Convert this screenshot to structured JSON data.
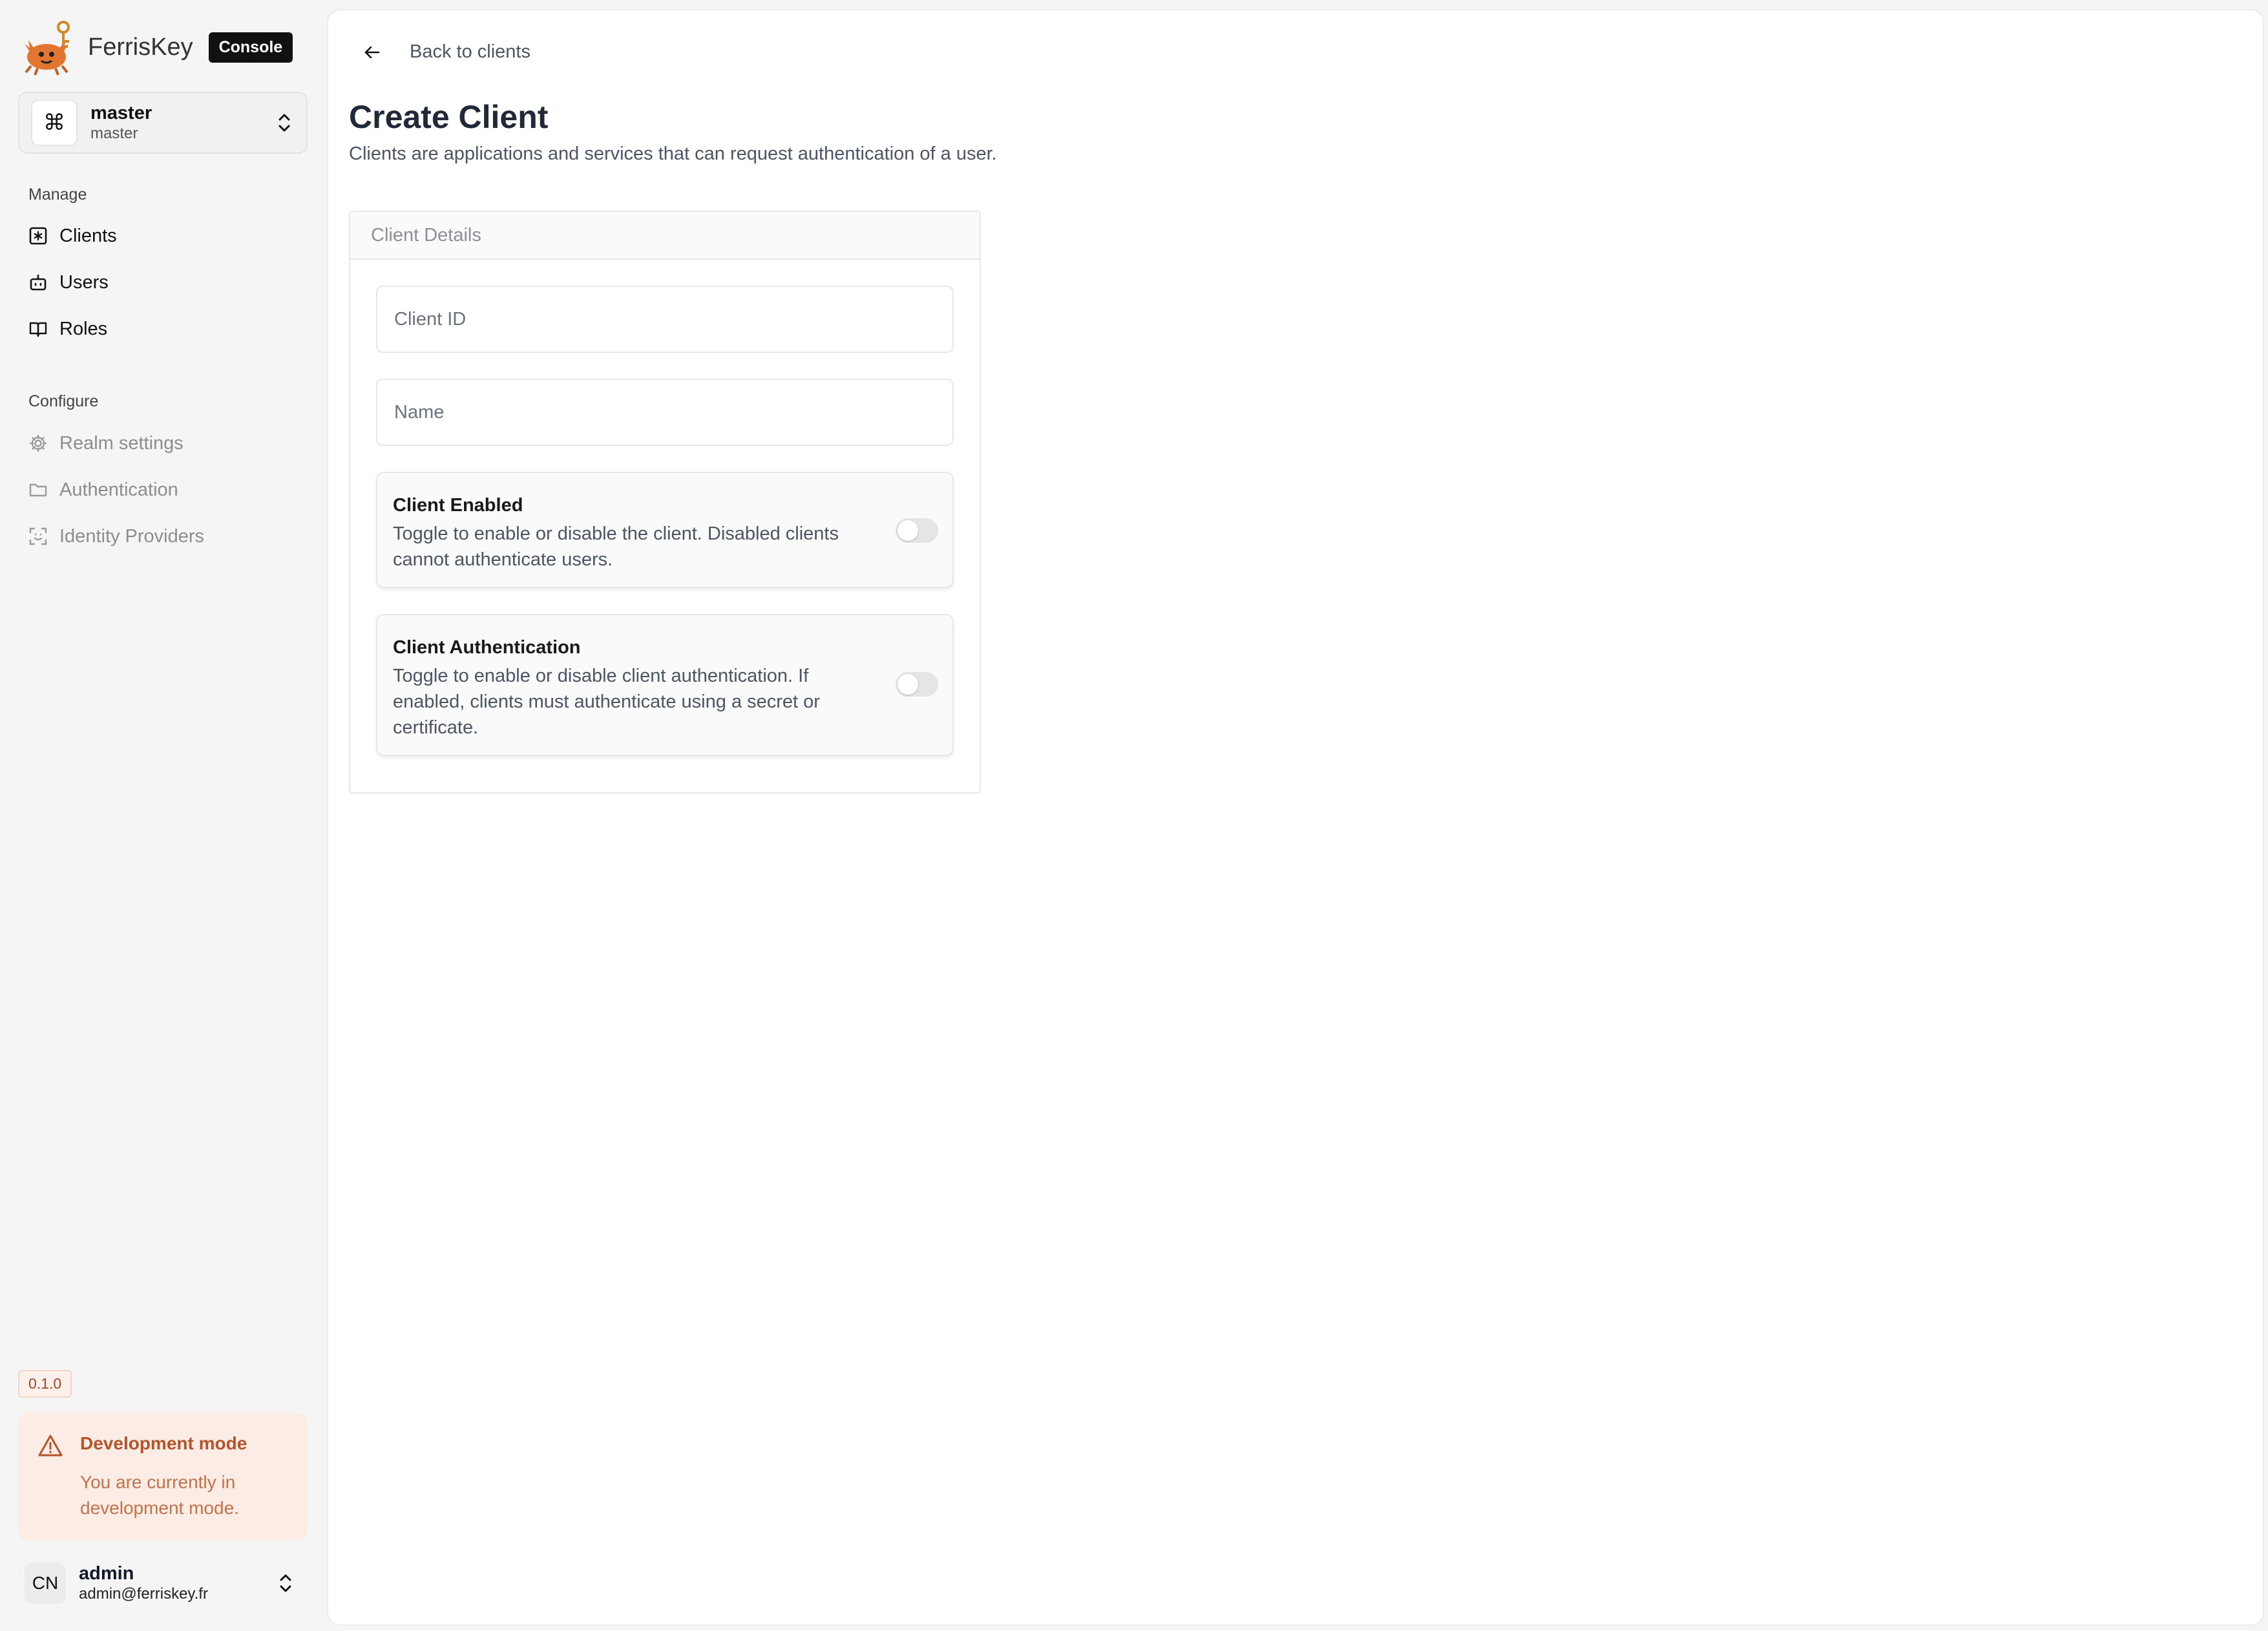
{
  "brand": {
    "name": "FerrisKey",
    "badge": "Console"
  },
  "realm": {
    "name": "master",
    "subtitle": "master",
    "icon": "command-icon"
  },
  "sidebar": {
    "manage_label": "Manage",
    "manage_items": [
      {
        "label": "Clients",
        "icon": "clients-icon",
        "active": true
      },
      {
        "label": "Users",
        "icon": "users-icon",
        "active": false
      },
      {
        "label": "Roles",
        "icon": "roles-book-icon",
        "active": false
      }
    ],
    "configure_label": "Configure",
    "configure_items": [
      {
        "label": "Realm settings",
        "icon": "gear-icon"
      },
      {
        "label": "Authentication",
        "icon": "folder-icon"
      },
      {
        "label": "Identity Providers",
        "icon": "scan-face-icon"
      }
    ],
    "version": "0.1.0",
    "dev_notice": {
      "title": "Development mode",
      "text": "You are currently in development mode.",
      "icon": "warning-triangle-icon"
    },
    "user": {
      "initials": "CN",
      "name": "admin",
      "email": "admin@ferriskey.fr"
    }
  },
  "main": {
    "back_label": "Back to clients",
    "title": "Create Client",
    "subtitle": "Clients are applications and services that can request authentication of a user.",
    "card_title": "Client Details",
    "fields": {
      "client_id": {
        "placeholder": "Client ID",
        "value": ""
      },
      "name": {
        "placeholder": "Name",
        "value": ""
      }
    },
    "toggles": {
      "enabled": {
        "title": "Client Enabled",
        "description": "Toggle to enable or disable the client. Disabled clients cannot authenticate users.",
        "on": false
      },
      "authentication": {
        "title": "Client Authentication",
        "description": "Toggle to enable or disable client authentication. If enabled, clients must authenticate using a secret or certificate.",
        "on": false
      }
    }
  },
  "colors": {
    "accent_dark": "#111111",
    "dev_mode_text": "#b5532b",
    "dev_mode_bg": "#fbece6",
    "muted_text": "#8d8d8d"
  }
}
